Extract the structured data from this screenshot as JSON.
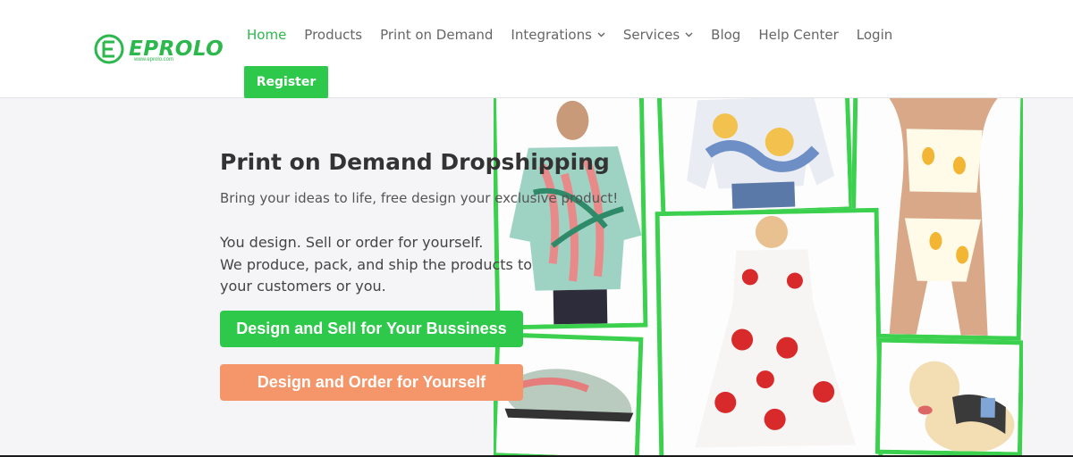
{
  "brand": {
    "name": "EPROLO",
    "sub": "www.eprolo.com",
    "color": "#2db84d"
  },
  "nav": {
    "items": [
      {
        "label": "Home",
        "active": true,
        "dropdown": false
      },
      {
        "label": "Products",
        "active": false,
        "dropdown": false
      },
      {
        "label": "Print on Demand",
        "active": false,
        "dropdown": false
      },
      {
        "label": "Integrations",
        "active": false,
        "dropdown": true
      },
      {
        "label": "Services",
        "active": false,
        "dropdown": true
      },
      {
        "label": "Blog",
        "active": false,
        "dropdown": false
      },
      {
        "label": "Help Center",
        "active": false,
        "dropdown": false
      },
      {
        "label": "Login",
        "active": false,
        "dropdown": false
      }
    ],
    "register_label": "Register"
  },
  "hero": {
    "title": "Print on Demand Dropshipping",
    "subtitle": "Bring your ideas to life, free design your exclusive product!",
    "line1": "You design. Sell or order for yourself.",
    "line2": "We produce, pack, and ship the products to",
    "line3": "your customers or you.",
    "primary_button": "Design and Sell for Your Bussiness",
    "secondary_button": "Design and Order for Yourself"
  },
  "colors": {
    "accent": "#2ec94b",
    "orange": "#f5956a",
    "frame": "#3bd04d"
  }
}
